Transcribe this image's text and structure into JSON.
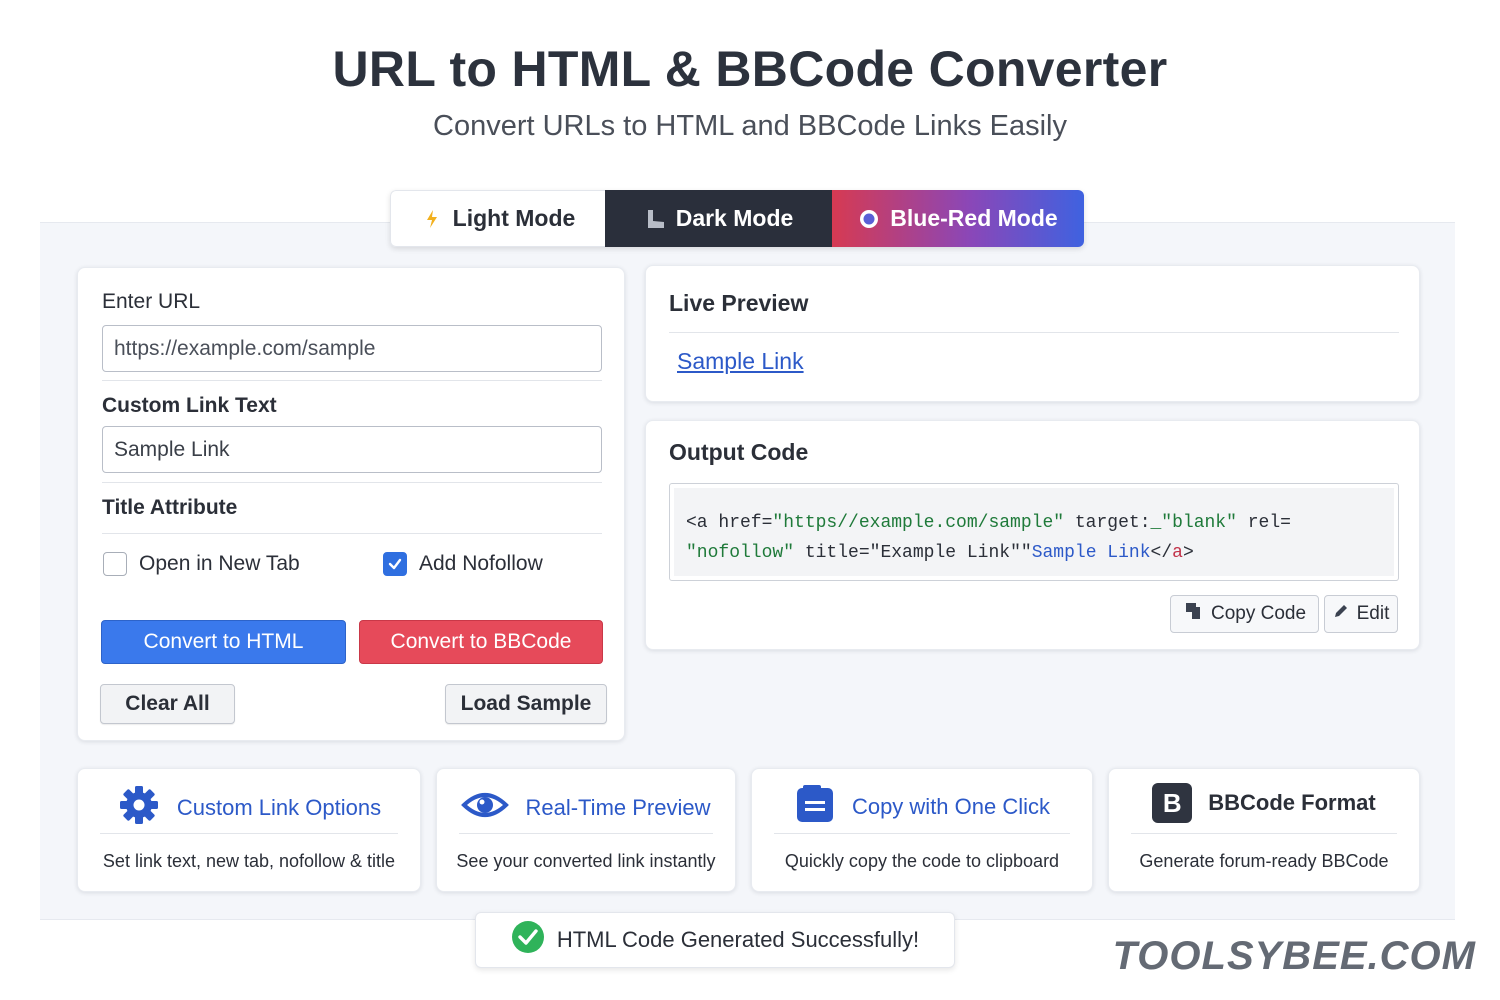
{
  "header": {
    "title": "URL to HTML & BBCode Converter",
    "subtitle": "Convert URLs to HTML and BBCode Links Easily"
  },
  "modes": {
    "light": "Light Mode",
    "dark": "Dark Mode",
    "blue_red": "Blue-Red Mode",
    "selected": "Dark Mode"
  },
  "form": {
    "url_label": "Enter URL",
    "url_placeholder": "https://example.com/sample",
    "link_text_label": "Custom Link Text",
    "link_text_value": "Sample Link",
    "title_label": "Title Attribute",
    "open_new_tab_label": "Open in New Tab",
    "open_new_tab_checked": false,
    "nofollow_label": "Add Nofollow",
    "nofollow_checked": true,
    "convert_html_label": "Convert to HTML",
    "convert_bbcode_label": "Convert to BBCode",
    "clear_label": "Clear All",
    "load_sample_label": "Load Sample"
  },
  "preview": {
    "heading": "Live Preview",
    "link_text": "Sample Link"
  },
  "output": {
    "heading": "Output Code",
    "code_line1_tag": "<a href=",
    "code_line1_href": "\"https//example.com/sample\"",
    "code_line1_target_attr": " target:",
    "code_line1_target_val": "_\"blank\"",
    "code_line1_rel": " rel=",
    "code_line2_rel_val": "\"nofollow\"",
    "code_line2_title_attr": " title=",
    "code_line2_title_val": "\"Example Link\"\"",
    "code_line2_text": "Sample Link",
    "code_line2_close_open": "</",
    "code_line2_close_tag": "a",
    "code_line2_close_end": ">",
    "copy_label": "Copy Code",
    "edit_label": "Edit"
  },
  "features": [
    {
      "title": "Custom Link Options",
      "desc": "Set link text, new tab, nofollow & title",
      "icon": "gear-icon"
    },
    {
      "title": "Real-Time Preview",
      "desc": "See your converted link instantly",
      "icon": "eye-icon"
    },
    {
      "title": "Copy with One Click",
      "desc": "Quickly copy the code to clipboard",
      "icon": "clipboard-icon"
    },
    {
      "title": "BBCode Format",
      "desc": "Generate forum-ready BBCode",
      "icon": "bbcode-b-icon",
      "badge": "B"
    }
  ],
  "toast": {
    "message": "HTML Code Generated Successfully!"
  },
  "watermark": "TOOLSYBEE.COM",
  "colors": {
    "accent_blue": "#3a79ec",
    "accent_red": "#e64a5a",
    "link_blue": "#2c59c8",
    "dark_mode_bg": "#2a2f3b",
    "success_green": "#2fb35a"
  }
}
